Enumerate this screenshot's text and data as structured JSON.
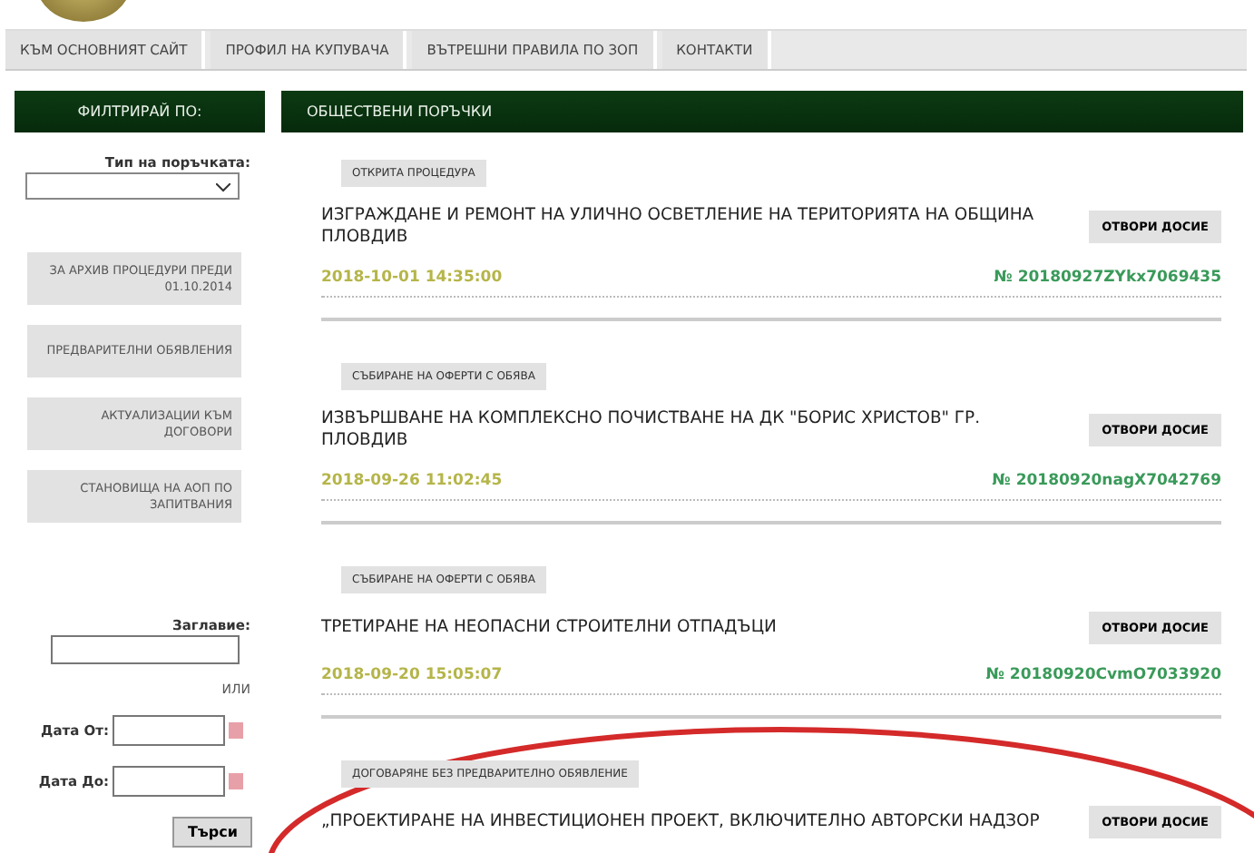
{
  "nav": {
    "items": [
      {
        "label": "КЪМ ОСНОВНИЯТ САЙТ"
      },
      {
        "label": "ПРОФИЛ НА КУПУВАЧА"
      },
      {
        "label": "ВЪТРЕШНИ ПРАВИЛА ПО ЗОП"
      },
      {
        "label": "КОНТАКТИ"
      }
    ]
  },
  "filter": {
    "heading": "ФИЛТРИРАЙ ПО:",
    "type_label": "Тип на поръчката:",
    "links": [
      "ЗА АРХИВ ПРОЦЕДУРИ ПРЕДИ 01.10.2014",
      "ПРЕДВАРИТЕЛНИ ОБЯВЛЕНИЯ",
      "АКТУАЛИЗАЦИИ КЪМ ДОГОВОРИ",
      "СТАНОВИЩА НА АОП ПО ЗАПИТВАНИЯ"
    ],
    "title_label": "Заглавие:",
    "or_label": "ИЛИ",
    "date_from_label": "Дата От:",
    "date_to_label": "Дата До:",
    "search_button": "Търси"
  },
  "main": {
    "heading": "ОБЩЕСТВЕНИ ПОРЪЧКИ",
    "procurements": [
      {
        "type": "ОТКРИТА ПРОЦЕДУРА",
        "title": "ИЗГРАЖДАНЕ И РЕМОНТ НА УЛИЧНО ОСВЕТЛЕНИЕ НА ТЕРИТОРИЯТА НА ОБЩИНА ПЛОВДИВ",
        "date": "2018-10-01 14:35:00",
        "number": "№ 20180927ZYkx7069435",
        "open_button": "ОТВОРИ ДОСИЕ"
      },
      {
        "type": "СЪБИРАНЕ НА ОФЕРТИ С ОБЯВА",
        "title": "ИЗВЪРШВАНЕ НА КОМПЛЕКСНО ПОЧИСТВАНЕ НА ДК \"БОРИС ХРИСТОВ\" ГР. ПЛОВДИВ",
        "date": "2018-09-26 11:02:45",
        "number": "№ 20180920nagX7042769",
        "open_button": "ОТВОРИ ДОСИЕ"
      },
      {
        "type": "СЪБИРАНЕ НА ОФЕРТИ С ОБЯВА",
        "title": "ТРЕТИРАНЕ НА НЕОПАСНИ СТРОИТЕЛНИ ОТПАДЪЦИ",
        "date": "2018-09-20 15:05:07",
        "number": "№ 20180920CvmO7033920",
        "open_button": "ОТВОРИ ДОСИЕ"
      },
      {
        "type": "ДОГОВАРЯНЕ БЕЗ ПРЕДВАРИТЕЛНО ОБЯВЛЕНИЕ",
        "title": "„ПРОЕКТИРАНЕ НА ИНВЕСТИЦИОНЕН ПРОЕКТ, ВКЛЮЧИТЕЛНО АВТОРСКИ НАДЗОР",
        "open_button": "ОТВОРИ ДОСИЕ"
      }
    ]
  }
}
